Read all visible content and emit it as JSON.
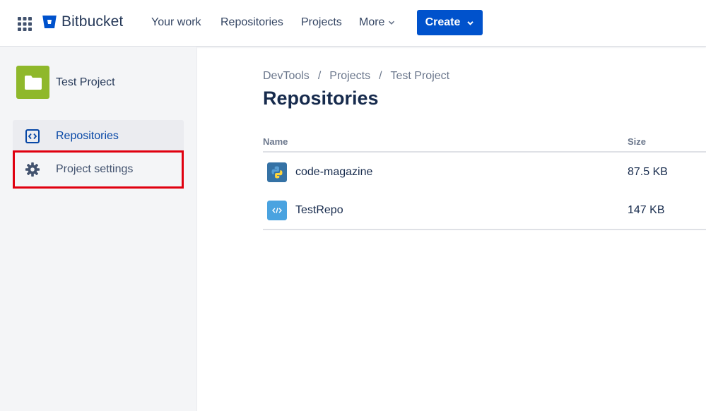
{
  "nav": {
    "brand": "Bitbucket",
    "items": [
      {
        "label": "Your work"
      },
      {
        "label": "Repositories"
      },
      {
        "label": "Projects"
      },
      {
        "label": "More"
      }
    ],
    "create_label": "Create",
    "icons": {
      "apps": "apps-grid-icon",
      "logo": "bitbucket-logo-icon",
      "chevron": "chevron-down-icon"
    }
  },
  "colors": {
    "accent": "#0052cc",
    "project_avatar": "#8fb82b",
    "highlight_border": "#e0000f",
    "sidebar_bg": "#f4f5f7"
  },
  "sidebar": {
    "project_name": "Test Project",
    "items": [
      {
        "label": "Repositories",
        "icon": "code-brackets-icon",
        "selected": true
      },
      {
        "label": "Project settings",
        "icon": "gear-icon",
        "selected": false
      }
    ]
  },
  "breadcrumb": [
    "DevTools",
    "Projects",
    "Test Project"
  ],
  "page": {
    "title": "Repositories"
  },
  "table": {
    "columns": [
      "Name",
      "Size"
    ],
    "rows": [
      {
        "name": "code-magazine",
        "size": "87.5 KB",
        "icon": "python-icon"
      },
      {
        "name": "TestRepo",
        "size": "147 KB",
        "icon": "code-file-icon"
      }
    ]
  }
}
